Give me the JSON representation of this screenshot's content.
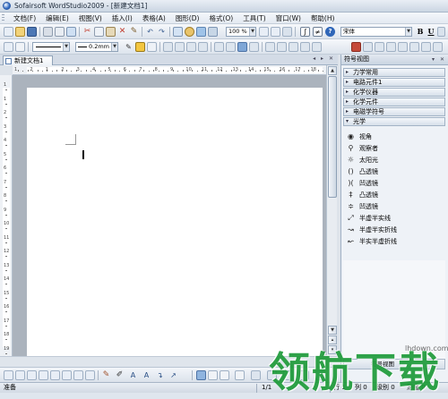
{
  "window": {
    "title": "Sofairsoft WordStudio2009 - [新建文档1]"
  },
  "menu": [
    "文档(F)",
    "编辑(E)",
    "视图(V)",
    "插入(I)",
    "表格(A)",
    "图形(D)",
    "格式(O)",
    "工具(T)",
    "窗口(W)",
    "帮助(H)"
  ],
  "toolbar1": {
    "zoom": "100 %",
    "font": "宋体",
    "bold": "B",
    "underline": "U"
  },
  "toolbar2": {
    "line_width": "0.2mm"
  },
  "doc_tab": {
    "label": "新建文档1"
  },
  "ruler": {
    "h_numbers": [
      "1",
      "2",
      "1",
      "2",
      "3",
      "4",
      "5",
      "6",
      "7",
      "8",
      "9",
      "10",
      "11",
      "12",
      "13",
      "14",
      "15",
      "16",
      "17",
      "18"
    ],
    "v_numbers": [
      "1",
      "1",
      "2",
      "3",
      "4",
      "5",
      "6",
      "7",
      "8",
      "9",
      "10",
      "11",
      "12",
      "13",
      "14",
      "15",
      "16",
      "17",
      "18",
      "19"
    ]
  },
  "panel": {
    "title": "符号视图",
    "categories": [
      "力学常用",
      "电路元件1",
      "化学仪器",
      "化学元件",
      "电磁学符号",
      "光学"
    ],
    "open_category": "光学",
    "symbols": [
      {
        "label": "视角",
        "icon": "eye-icon"
      },
      {
        "label": "观察者",
        "icon": "observer-icon"
      },
      {
        "label": "太阳光",
        "icon": "sun-icon"
      },
      {
        "label": "凸透镜",
        "icon": "convex-lens-icon"
      },
      {
        "label": "凹透镜",
        "icon": "concave-lens-icon"
      },
      {
        "label": "凸透镜",
        "icon": "convex-lens-icon"
      },
      {
        "label": "凹透镜",
        "icon": "concave-lens-icon"
      },
      {
        "label": "半虚半实线",
        "icon": "half-dashed-line-icon"
      },
      {
        "label": "半虚半实折线",
        "icon": "half-dashed-polyline-icon"
      },
      {
        "label": "半实半虚折线",
        "icon": "half-solid-polyline-icon"
      }
    ],
    "bottom_label": "符号视图"
  },
  "status": {
    "ready": "准备",
    "page": "1/1",
    "row": "行 1",
    "col": "列 0",
    "level": "级别 0",
    "depth": "深度 0"
  },
  "watermark": {
    "text": "领航下载",
    "url": "lhdown.com"
  }
}
